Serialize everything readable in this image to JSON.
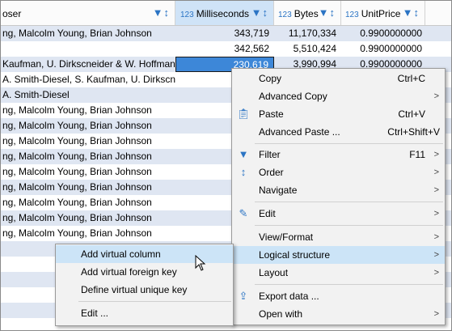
{
  "header": {
    "col0": {
      "label": "oser"
    },
    "col1": {
      "type": "123",
      "label": "Milliseconds"
    },
    "col2": {
      "type": "123",
      "label": "Bytes"
    },
    "col3": {
      "type": "123",
      "label": "UnitPrice"
    }
  },
  "rows": [
    {
      "composer": "ng, Malcolm Young, Brian Johnson",
      "ms": "343,719",
      "bytes": "11,170,334",
      "price": "0.9900000000"
    },
    {
      "composer": "",
      "ms": "342,562",
      "bytes": "5,510,424",
      "price": "0.9900000000"
    },
    {
      "composer": "Kaufman, U. Dirkscneider & W. Hoffman",
      "ms": "230,619",
      "bytes": "3,990,994",
      "price": "0.9900000000"
    },
    {
      "composer": "A. Smith-Diesel, S. Kaufman, U. Dirkscne",
      "ms": "",
      "bytes": "",
      "price": ""
    },
    {
      "composer": "A. Smith-Diesel",
      "ms": "",
      "bytes": "",
      "price": ""
    },
    {
      "composer": "ng, Malcolm Young, Brian Johnson",
      "ms": "",
      "bytes": "",
      "price": ""
    },
    {
      "composer": "ng, Malcolm Young, Brian Johnson",
      "ms": "",
      "bytes": "",
      "price": ""
    },
    {
      "composer": "ng, Malcolm Young, Brian Johnson",
      "ms": "",
      "bytes": "",
      "price": ""
    },
    {
      "composer": "ng, Malcolm Young, Brian Johnson",
      "ms": "",
      "bytes": "",
      "price": ""
    },
    {
      "composer": "ng, Malcolm Young, Brian Johnson",
      "ms": "",
      "bytes": "",
      "price": ""
    },
    {
      "composer": "ng, Malcolm Young, Brian Johnson",
      "ms": "",
      "bytes": "",
      "price": ""
    },
    {
      "composer": "ng, Malcolm Young, Brian Johnson",
      "ms": "",
      "bytes": "",
      "price": ""
    },
    {
      "composer": "ng, Malcolm Young, Brian Johnson",
      "ms": "",
      "bytes": "",
      "price": ""
    },
    {
      "composer": "ng, Malcolm Young, Brian Johnson",
      "ms": "",
      "bytes": "",
      "price": ""
    }
  ],
  "context_menu": {
    "copy": {
      "label": "Copy",
      "shortcut": "Ctrl+C"
    },
    "advanced_copy": {
      "label": "Advanced Copy"
    },
    "paste": {
      "label": "Paste",
      "shortcut": "Ctrl+V"
    },
    "advanced_paste": {
      "label": "Advanced Paste ...",
      "shortcut": "Ctrl+Shift+V"
    },
    "filter": {
      "label": "Filter",
      "shortcut": "F11"
    },
    "order": {
      "label": "Order"
    },
    "navigate": {
      "label": "Navigate"
    },
    "edit": {
      "label": "Edit"
    },
    "view_format": {
      "label": "View/Format"
    },
    "logical_structure": {
      "label": "Logical structure"
    },
    "layout": {
      "label": "Layout"
    },
    "export_data": {
      "label": "Export data ..."
    },
    "open_with": {
      "label": "Open with"
    }
  },
  "submenu": {
    "add_virtual_column": "Add virtual column",
    "add_virtual_foreign_key": "Add virtual foreign key",
    "define_virtual_unique_key": "Define virtual unique key",
    "edit": "Edit ..."
  },
  "colors": {
    "accent": "#2b74c4",
    "selected_cell": "#3d87d8",
    "row_alt": "#dfe6f2",
    "menu_highlight": "#cce4f7"
  }
}
